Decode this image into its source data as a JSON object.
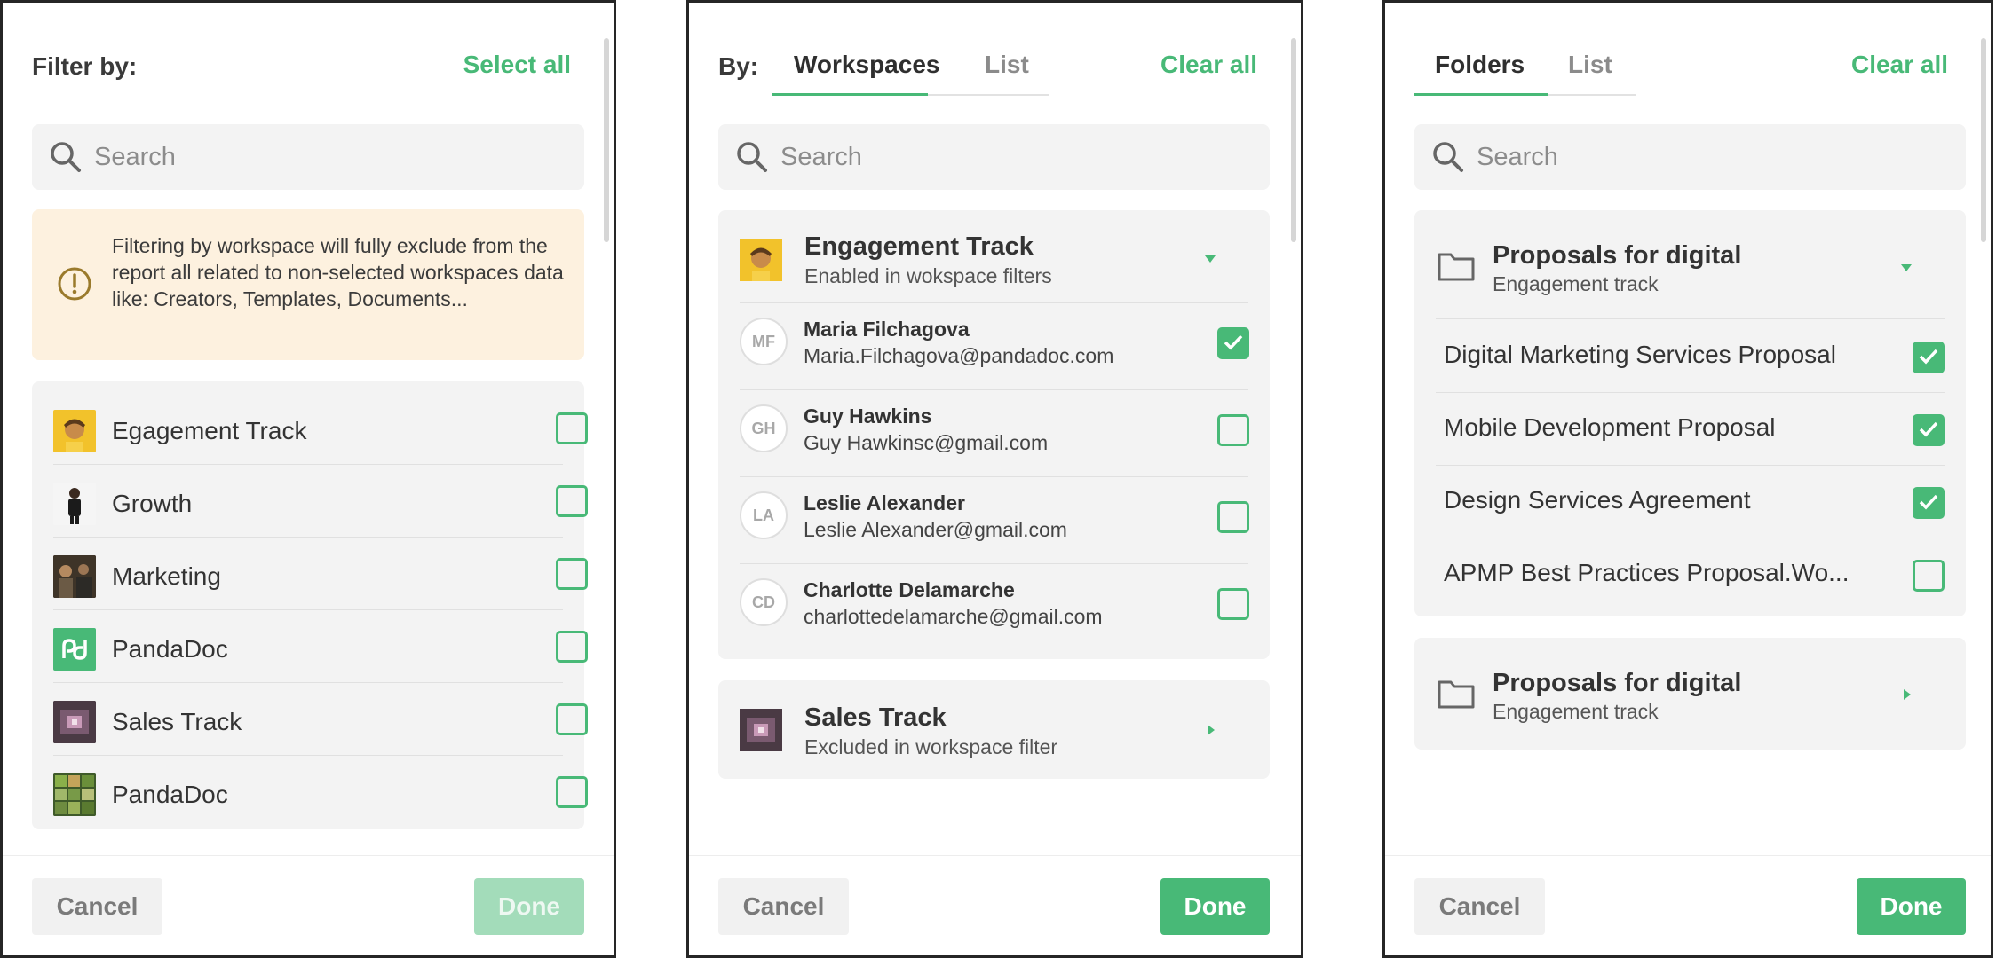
{
  "colors": {
    "accent": "#48b977",
    "notice_bg": "#fdf1df",
    "surface": "#f3f3f3"
  },
  "panel1": {
    "title": "Filter by:",
    "select_all": "Select all",
    "search_placeholder": "Search",
    "notice": "Filtering by workspace will fully exclude from the report all related to non-selected workspaces data like: Creators, Templates, Documents...",
    "workspaces": [
      {
        "label": "Egagement Track",
        "icon": "avatar-thumbnail",
        "checked": false
      },
      {
        "label": "Growth",
        "icon": "person-thumbnail",
        "checked": false
      },
      {
        "label": "Marketing",
        "icon": "photo-thumbnail",
        "checked": false
      },
      {
        "label": "PandaDoc",
        "icon": "pandadoc-logo",
        "checked": false
      },
      {
        "label": "Sales Track",
        "icon": "tunnel-thumbnail",
        "checked": false
      },
      {
        "label": "PandaDoc",
        "icon": "grid-thumbnail",
        "checked": false
      }
    ],
    "cancel": "Cancel",
    "done": "Done"
  },
  "panel2": {
    "by_label": "By:",
    "tabs": [
      {
        "label": "Workspaces",
        "active": true
      },
      {
        "label": "List",
        "active": false
      }
    ],
    "clear_all": "Clear all",
    "search_placeholder": "Search",
    "group1": {
      "title": "Engagement Track",
      "subtitle": "Enabled in wokspace filters",
      "members": [
        {
          "initials": "MF",
          "name": "Maria Filchagova",
          "email": "Maria.Filchagova@pandadoc.com",
          "checked": true
        },
        {
          "initials": "GH",
          "name": "Guy Hawkins",
          "email": "Guy Hawkinsc@gmail.com",
          "checked": false
        },
        {
          "initials": "LA",
          "name": "Leslie Alexander",
          "email": "Leslie Alexander@gmail.com",
          "checked": false
        },
        {
          "initials": "CD",
          "name": "Charlotte Delamarche",
          "email": "charlottedelamarche@gmail.com",
          "checked": false
        }
      ]
    },
    "group2": {
      "title": "Sales Track",
      "subtitle": "Excluded in workspace filter"
    },
    "cancel": "Cancel",
    "done": "Done"
  },
  "panel3": {
    "tabs": [
      {
        "label": "Folders",
        "active": true
      },
      {
        "label": "List",
        "active": false
      }
    ],
    "clear_all": "Clear all",
    "search_placeholder": "Search",
    "folder1": {
      "title": "Proposals for digital",
      "subtitle": "Engagement track",
      "docs": [
        {
          "label": "Digital Marketing Services Proposal",
          "checked": true
        },
        {
          "label": "Mobile Development Proposal",
          "checked": true
        },
        {
          "label": "Design Services Agreement",
          "checked": true
        },
        {
          "label": "APMP Best Practices Proposal.Wo...",
          "checked": false
        }
      ]
    },
    "folder2": {
      "title": "Proposals for digital",
      "subtitle": "Engagement track"
    },
    "cancel": "Cancel",
    "done": "Done"
  }
}
